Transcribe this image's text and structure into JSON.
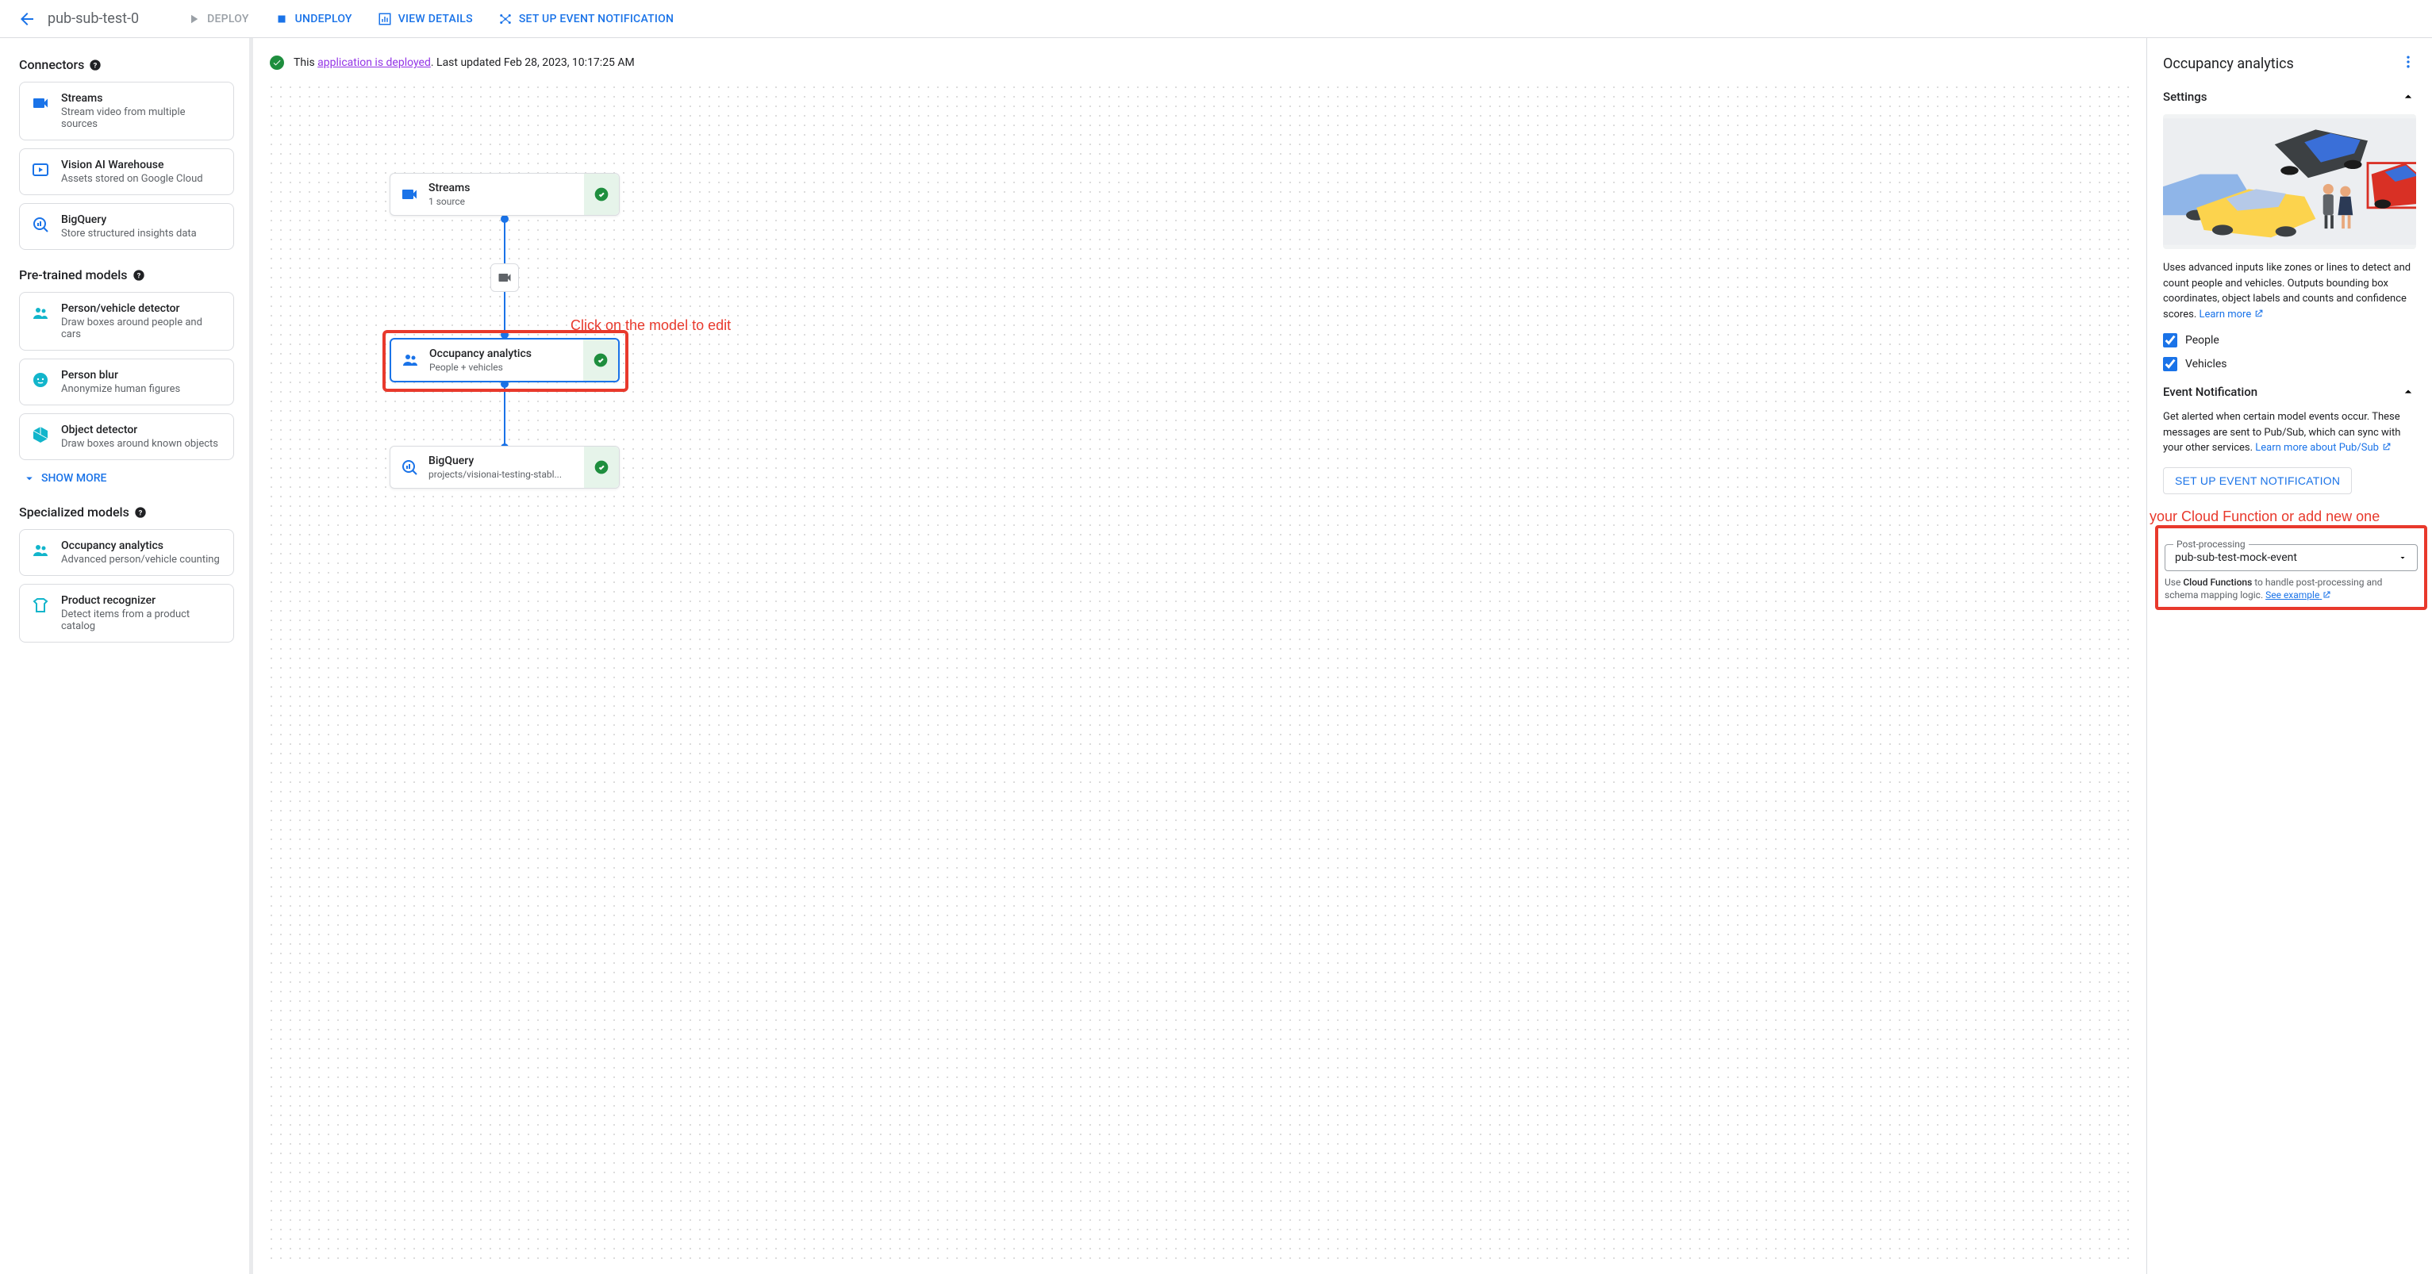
{
  "header": {
    "title": "pub-sub-test-0",
    "deploy": "DEPLOY",
    "undeploy": "UNDEPLOY",
    "view_details": "VIEW DETAILS",
    "setup_event": "SET UP EVENT NOTIFICATION"
  },
  "status": {
    "prefix": "This ",
    "link": "application is deployed",
    "suffix": ". Last updated Feb 28, 2023, 10:17:25 AM"
  },
  "sidebar": {
    "connectors_title": "Connectors",
    "pretrained_title": "Pre-trained models",
    "specialized_title": "Specialized models",
    "show_more": "SHOW MORE",
    "connectors": [
      {
        "title": "Streams",
        "desc": "Stream video from multiple sources"
      },
      {
        "title": "Vision AI Warehouse",
        "desc": "Assets stored on Google Cloud"
      },
      {
        "title": "BigQuery",
        "desc": "Store structured insights data"
      }
    ],
    "pretrained": [
      {
        "title": "Person/vehicle detector",
        "desc": "Draw boxes around people and cars"
      },
      {
        "title": "Person blur",
        "desc": "Anonymize human figures"
      },
      {
        "title": "Object detector",
        "desc": "Draw boxes around known objects"
      }
    ],
    "specialized": [
      {
        "title": "Occupancy analytics",
        "desc": "Advanced person/vehicle counting"
      },
      {
        "title": "Product recognizer",
        "desc": "Detect items from a product catalog"
      }
    ]
  },
  "nodes": {
    "streams": {
      "title": "Streams",
      "desc": "1 source"
    },
    "occupancy": {
      "title": "Occupancy analytics",
      "desc": "People + vehicles"
    },
    "bigquery": {
      "title": "BigQuery",
      "desc": "projects/visionai-testing-stabl..."
    }
  },
  "annotations": {
    "model": "Click on the model to edit",
    "cloudfn": "Select your Cloud Function or add new one"
  },
  "rpanel": {
    "title": "Occupancy analytics",
    "settings": "Settings",
    "desc_pre": "Uses advanced inputs like zones or lines to detect and count people and vehicles. Outputs bounding box coordinates, object labels and counts and confidence scores. ",
    "learn_more": "Learn more",
    "people": "People",
    "vehicles": "Vehicles",
    "event_notif": "Event Notification",
    "event_desc_pre": "Get alerted when certain model events occur. These messages are sent to Pub/Sub, which can sync with your other services. ",
    "event_learn": "Learn more about Pub/Sub",
    "setup_btn": "SET UP EVENT NOTIFICATION",
    "pp_label": "Post-processing",
    "pp_value": "pub-sub-test-mock-event",
    "pp_help_pre": "Use ",
    "pp_help_bold": "Cloud Functions",
    "pp_help_post": " to handle post-processing and schema mapping logic. ",
    "pp_help_link": "See example"
  }
}
